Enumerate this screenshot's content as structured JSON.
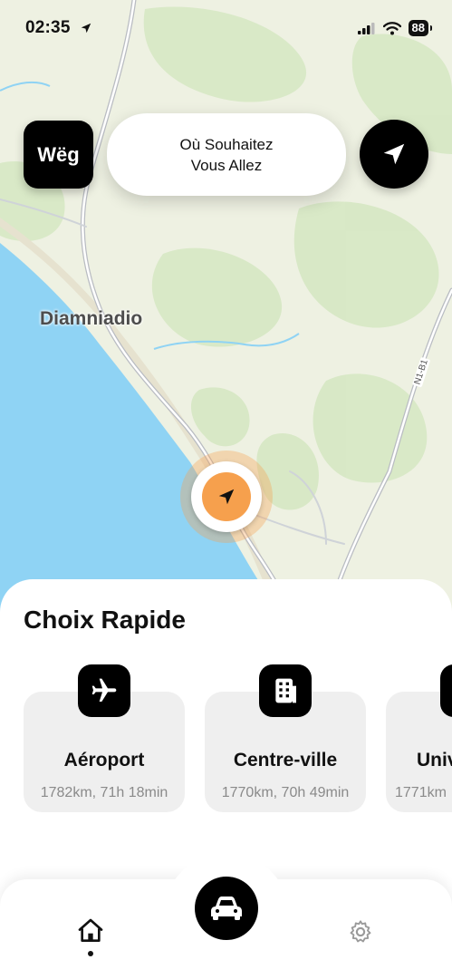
{
  "status_bar": {
    "time": "02:35",
    "battery": "88"
  },
  "header": {
    "logo": "Wëg",
    "search_placeholder": "Où Souhaitez\nVous Allez"
  },
  "map": {
    "place_label": "Diamniadio",
    "road_label": "N1-B1"
  },
  "quick_choice": {
    "title": "Choix Rapide",
    "items": [
      {
        "name": "Aéroport",
        "distance": "1782km, 71h 18min",
        "icon": "airplane-icon"
      },
      {
        "name": "Centre-ville",
        "distance": "1770km, 70h 49min",
        "icon": "building-icon"
      },
      {
        "name": "Univ",
        "distance": "1771km",
        "icon": "university-icon"
      }
    ]
  },
  "tab_bar": {
    "tabs": [
      "home-icon",
      "car-icon",
      "gear-icon"
    ]
  },
  "colors": {
    "accent": "#F6A04D",
    "water": "#8FD3F4",
    "land": "#EEF1E2",
    "greenery": "#D4E6C2"
  }
}
